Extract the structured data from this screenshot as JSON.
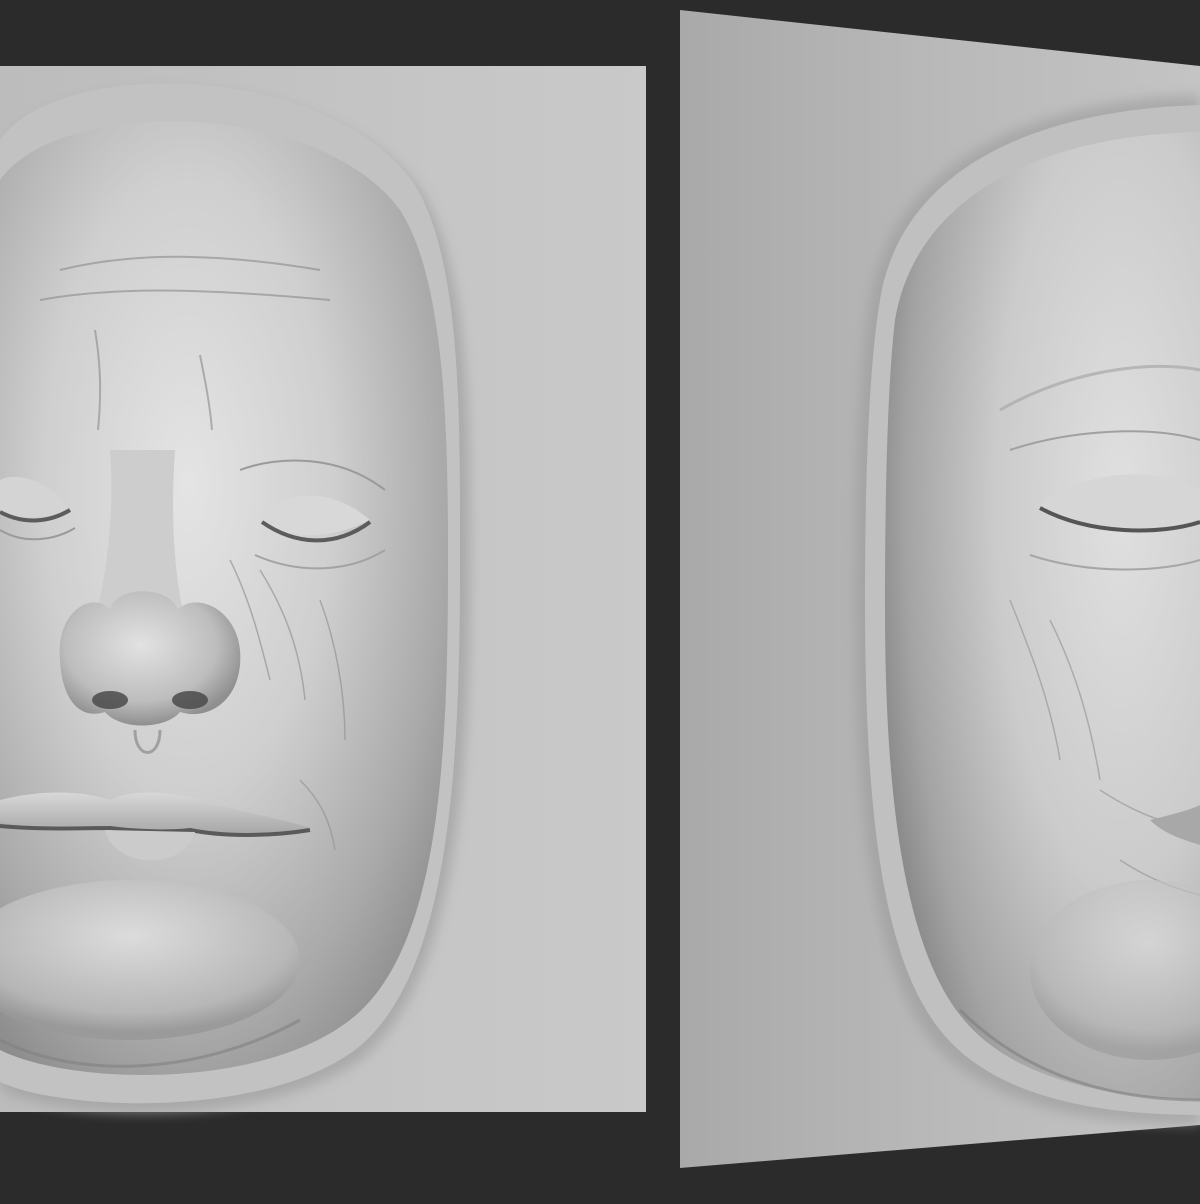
{
  "canvas": {
    "background_color": "#2b2b2b",
    "panel_color": "#c4c4c4",
    "sculpt_color": "#bdbdbd"
  },
  "views": [
    {
      "name": "front-view"
    },
    {
      "name": "three-quarter-view"
    }
  ]
}
